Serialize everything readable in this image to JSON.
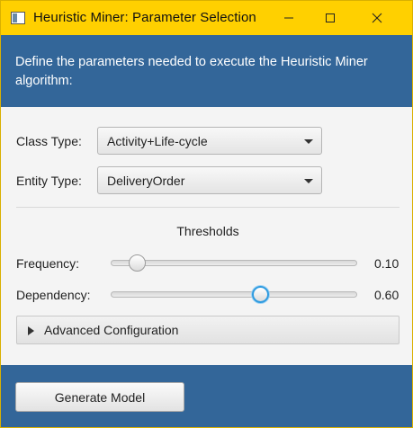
{
  "window": {
    "title": "Heuristic Miner: Parameter Selection",
    "controls": {
      "minimize_icon": "minimize-icon",
      "maximize_icon": "maximize-icon",
      "close_icon": "close-icon"
    }
  },
  "header": {
    "text": "Define the parameters needed to execute the Heuristic Miner algorithm:"
  },
  "form": {
    "class_type": {
      "label": "Class Type:",
      "value": "Activity+Life-cycle"
    },
    "entity_type": {
      "label": "Entity Type:",
      "value": "DeliveryOrder"
    }
  },
  "thresholds": {
    "title": "Thresholds",
    "frequency": {
      "label": "Frequency:",
      "value": 0.1,
      "value_text": "0.10"
    },
    "dependency": {
      "label": "Dependency:",
      "value": 0.6,
      "value_text": "0.60"
    }
  },
  "advanced": {
    "label": "Advanced Configuration",
    "expanded": false
  },
  "footer": {
    "generate_label": "Generate Model"
  },
  "colors": {
    "titlebar": "#ffd000",
    "accent_blue": "#336699",
    "focus_ring": "#2e9be0"
  }
}
